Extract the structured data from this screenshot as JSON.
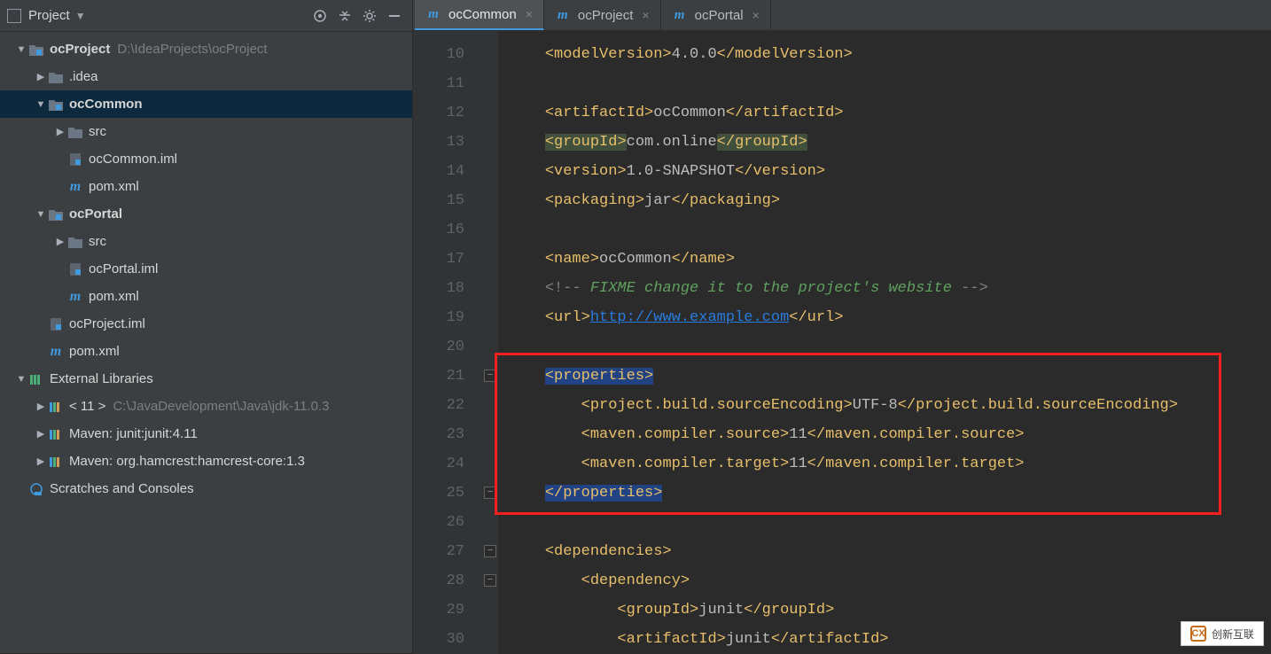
{
  "sidebar": {
    "title": "Project",
    "project": {
      "name": "ocProject",
      "path": "D:\\IdeaProjects\\ocProject"
    },
    "rows": [
      {
        "depth": 0,
        "arrow": "▼",
        "icon": "module",
        "label": "ocProject",
        "bold": true,
        "path": "D:\\IdeaProjects\\ocProject"
      },
      {
        "depth": 1,
        "arrow": "▶",
        "icon": "folder",
        "label": ".idea"
      },
      {
        "depth": 1,
        "arrow": "▼",
        "icon": "module",
        "label": "ocCommon",
        "bold": true,
        "sel": true
      },
      {
        "depth": 2,
        "arrow": "▶",
        "icon": "folder",
        "label": "src"
      },
      {
        "depth": 2,
        "arrow": "",
        "icon": "iml",
        "label": "ocCommon.iml"
      },
      {
        "depth": 2,
        "arrow": "",
        "icon": "m",
        "label": "pom.xml"
      },
      {
        "depth": 1,
        "arrow": "▼",
        "icon": "module",
        "label": "ocPortal",
        "bold": true
      },
      {
        "depth": 2,
        "arrow": "▶",
        "icon": "folder",
        "label": "src"
      },
      {
        "depth": 2,
        "arrow": "",
        "icon": "iml",
        "label": "ocPortal.iml"
      },
      {
        "depth": 2,
        "arrow": "",
        "icon": "m",
        "label": "pom.xml"
      },
      {
        "depth": 1,
        "arrow": "",
        "icon": "iml",
        "label": "ocProject.iml"
      },
      {
        "depth": 1,
        "arrow": "",
        "icon": "m",
        "label": "pom.xml"
      },
      {
        "depth": 0,
        "arrow": "▼",
        "icon": "libroot",
        "label": "External Libraries"
      },
      {
        "depth": 1,
        "arrow": "▶",
        "icon": "lib",
        "label": "< 11 >",
        "path": "C:\\JavaDevelopment\\Java\\jdk-11.0.3"
      },
      {
        "depth": 1,
        "arrow": "▶",
        "icon": "lib",
        "label": "Maven: junit:junit:4.11"
      },
      {
        "depth": 1,
        "arrow": "▶",
        "icon": "lib",
        "label": "Maven: org.hamcrest:hamcrest-core:1.3"
      },
      {
        "depth": 0,
        "arrow": "",
        "icon": "scratch",
        "label": "Scratches and Consoles"
      }
    ]
  },
  "tabs": [
    {
      "label": "ocCommon",
      "active": true
    },
    {
      "label": "ocProject",
      "active": false
    },
    {
      "label": "ocPortal",
      "active": false
    }
  ],
  "lineStart": 10,
  "lineEnd": 30,
  "code": {
    "modelVersion": "4.0.0",
    "artifactId": "ocCommon",
    "groupId": "com.online",
    "version": "1.0-SNAPSHOT",
    "packaging": "jar",
    "name": "ocCommon",
    "fixme": " FIXME change it to the project's website ",
    "url": "http://www.example.com",
    "encoding": "UTF-8",
    "compilerSource": "11",
    "compilerTarget": "11",
    "depGroupId": "junit",
    "depArtifactId": "junit"
  },
  "watermark": "创新互联"
}
